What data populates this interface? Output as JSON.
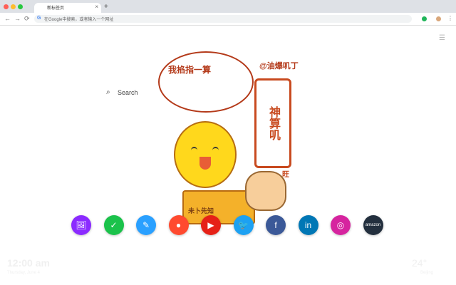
{
  "browser": {
    "tab_title": "新标签页",
    "tab_close": "×",
    "new_tab": "+",
    "omnibox_placeholder": "在Google中搜索，或者输入一个网址",
    "menu": "⋮"
  },
  "page": {
    "watermark": "@油爆叽丁",
    "search_placeholder": "Search",
    "speech_text": "我掐指一算",
    "sign_text": "神算叽",
    "podium_text": "未卜先知",
    "dog_tag": "旺",
    "time": "12:00 am",
    "time_subtitle": "Thursday, June 4",
    "weather_temp": "24°",
    "weather_location": "Beijing"
  },
  "quick_links": [
    {
      "name": "image",
      "label": "🖼",
      "color": "#8b2bff"
    },
    {
      "name": "tasks",
      "label": "✓",
      "color": "#1bc24b"
    },
    {
      "name": "notes",
      "label": "✎",
      "color": "#2aa0ff"
    },
    {
      "name": "paint",
      "label": "●",
      "color": "#ff4a2f"
    },
    {
      "name": "youtube",
      "label": "▶",
      "color": "#e62117"
    },
    {
      "name": "twitter",
      "label": "🐦",
      "color": "#1da1f2"
    },
    {
      "name": "facebook",
      "label": "f",
      "color": "#3b5998"
    },
    {
      "name": "linkedin",
      "label": "in",
      "color": "#0077b5"
    },
    {
      "name": "instagram",
      "label": "◎",
      "color": "#d6249f"
    },
    {
      "name": "amazon",
      "label": "amazon",
      "color": "#232f3e"
    }
  ]
}
